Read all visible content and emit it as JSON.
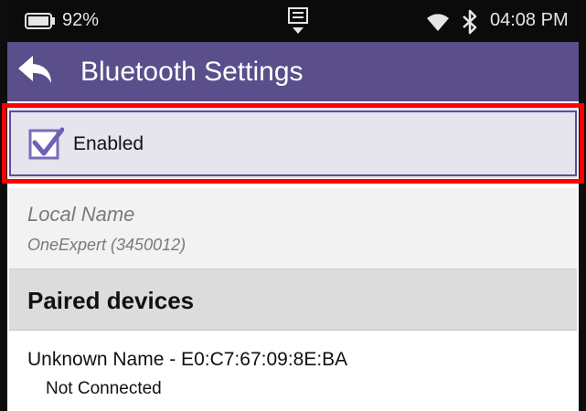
{
  "status_bar": {
    "battery_percent": "92%",
    "time": "04:08 PM",
    "icons": [
      "battery-icon",
      "notification-icon",
      "wifi-icon",
      "bluetooth-icon"
    ]
  },
  "app_bar": {
    "title": "Bluetooth Settings",
    "back_icon": "back-arrow-icon",
    "color": "#5a4f8a"
  },
  "enabled": {
    "label": "Enabled",
    "checked": true,
    "highlight_color": "#ff0000"
  },
  "local_name": {
    "label": "Local Name",
    "value": "OneExpert (3450012)"
  },
  "paired_devices": {
    "header": "Paired devices",
    "items": [
      {
        "name": "Unknown Name - E0:C7:67:09:8E:BA",
        "status": "Not Connected"
      }
    ]
  }
}
